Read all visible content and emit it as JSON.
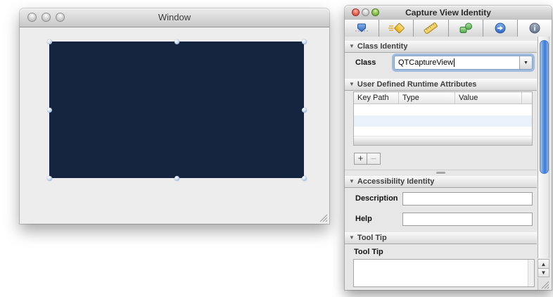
{
  "left_window": {
    "title": "Window",
    "view_color": "#152540"
  },
  "inspector": {
    "title": "Capture View Identity",
    "toolbar_icons": [
      {
        "name": "attributes-inspector-icon",
        "selected": false
      },
      {
        "name": "effects-inspector-icon",
        "selected": false
      },
      {
        "name": "size-inspector-icon",
        "selected": false
      },
      {
        "name": "bindings-inspector-icon",
        "selected": false
      },
      {
        "name": "connections-inspector-icon",
        "selected": false
      },
      {
        "name": "identity-inspector-icon",
        "selected": true
      }
    ],
    "class_identity": {
      "header": "Class Identity",
      "class_label": "Class",
      "class_value": "QTCaptureView"
    },
    "runtime_attributes": {
      "header": "User Defined Runtime Attributes",
      "columns": [
        "Key Path",
        "Type",
        "Value"
      ],
      "rows": [],
      "add_button": "+",
      "remove_button": "–"
    },
    "accessibility": {
      "header": "Accessibility Identity",
      "description_label": "Description",
      "description_value": "",
      "help_label": "Help",
      "help_value": ""
    },
    "tool_tip": {
      "header": "Tool Tip",
      "label": "Tool Tip",
      "value": ""
    },
    "colors": {
      "focus_ring": "#78a5dc",
      "scrollbar_thumb": "#4f86da",
      "table_alt_row": "#e9f1fa"
    },
    "scrollbar": {
      "up_glyph": "▲",
      "down_glyph": "▼"
    }
  }
}
